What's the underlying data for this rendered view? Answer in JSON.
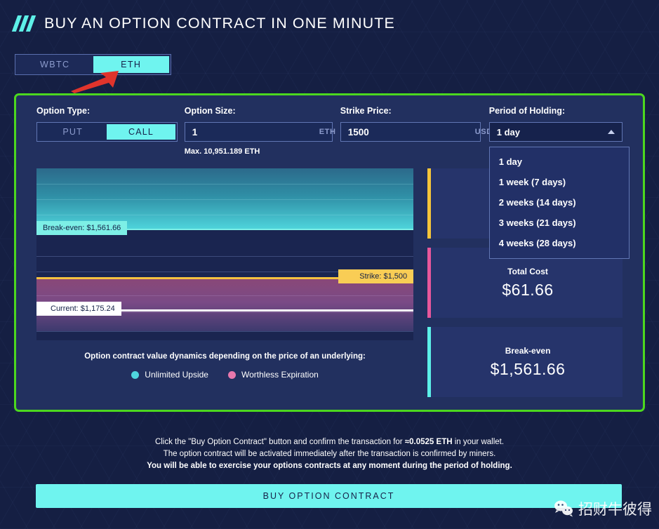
{
  "header": {
    "title": "BUY AN OPTION CONTRACT IN ONE MINUTE",
    "logo_icon": "triple-slash-icon"
  },
  "asset_tabs": [
    {
      "label": "WBTC",
      "active": false
    },
    {
      "label": "ETH",
      "active": true
    }
  ],
  "annotation": {
    "arrow_icon": "red-arrow-icon",
    "arrow_color": "#e0342c"
  },
  "form": {
    "option_type": {
      "label": "Option Type:",
      "options": [
        {
          "label": "PUT",
          "active": false
        },
        {
          "label": "CALL",
          "active": true
        }
      ]
    },
    "option_size": {
      "label": "Option Size:",
      "value": "1",
      "placeholder": "0",
      "unit": "ETH",
      "hint": "Max. 10,951.189 ETH"
    },
    "strike_price": {
      "label": "Strike Price:",
      "value": "1500",
      "placeholder": "0",
      "unit": "USD"
    },
    "period_of_holding": {
      "label": "Period of Holding:",
      "selected": "1 day",
      "expanded": true,
      "caret_icon": "chevron-up-icon",
      "options": [
        "1 day",
        "1 week (7 days)",
        "2 weeks (14 days)",
        "3 weeks (21 days)",
        "4 weeks (28 days)"
      ]
    }
  },
  "chart_data": {
    "type": "area",
    "title": "Option contract value dynamics depending on the price of an underlying:",
    "series": [
      {
        "name": "Unlimited Upside",
        "color": "#4fd6dd",
        "region": "above-break-even"
      },
      {
        "name": "Worthless Expiration",
        "color": "#e878ad",
        "region": "below-strike"
      }
    ],
    "markers": [
      {
        "name": "Break-even",
        "label": "Break-even: $1,561.66",
        "value": 1561.66,
        "color": "#7defe6",
        "align": "left"
      },
      {
        "name": "Strike",
        "label": "Strike: $1,500",
        "value": 1500,
        "color": "#f9cd55",
        "align": "right"
      },
      {
        "name": "Current",
        "label": "Current: $1,175.24",
        "value": 1175.24,
        "color": "#ffffff",
        "align": "left"
      }
    ],
    "legend": [
      {
        "label": "Unlimited Upside",
        "color": "#4fd6dd"
      },
      {
        "label": "Worthless Expiration",
        "color": "#e878ad"
      }
    ],
    "grid": true,
    "legend_position": "bottom"
  },
  "panels": [
    {
      "name": "period-panel",
      "label": "",
      "value": "",
      "bar_color": "#f5c53a"
    },
    {
      "name": "total-cost-panel",
      "label": "Total Cost",
      "value": "$61.66",
      "bar_color": "#e8579b"
    },
    {
      "name": "break-even-panel",
      "label": "Break-even",
      "value": "$1,561.66",
      "bar_color": "#5cf0e8"
    }
  ],
  "footer": {
    "line1_a": "Click the \"Buy Option Contract\" button and confirm the transaction for ",
    "line1_b": "≈0.0525 ETH",
    "line1_c": " in your wallet.",
    "line2": "The option contract will be activated immediately after the transaction is confirmed by miners.",
    "line3": "You will be able to exercise your options contracts at any moment during the period of holding.",
    "buy_button": "BUY OPTION CONTRACT"
  },
  "watermark": {
    "text": "招财牛彼得",
    "icon": "wechat-icon"
  }
}
